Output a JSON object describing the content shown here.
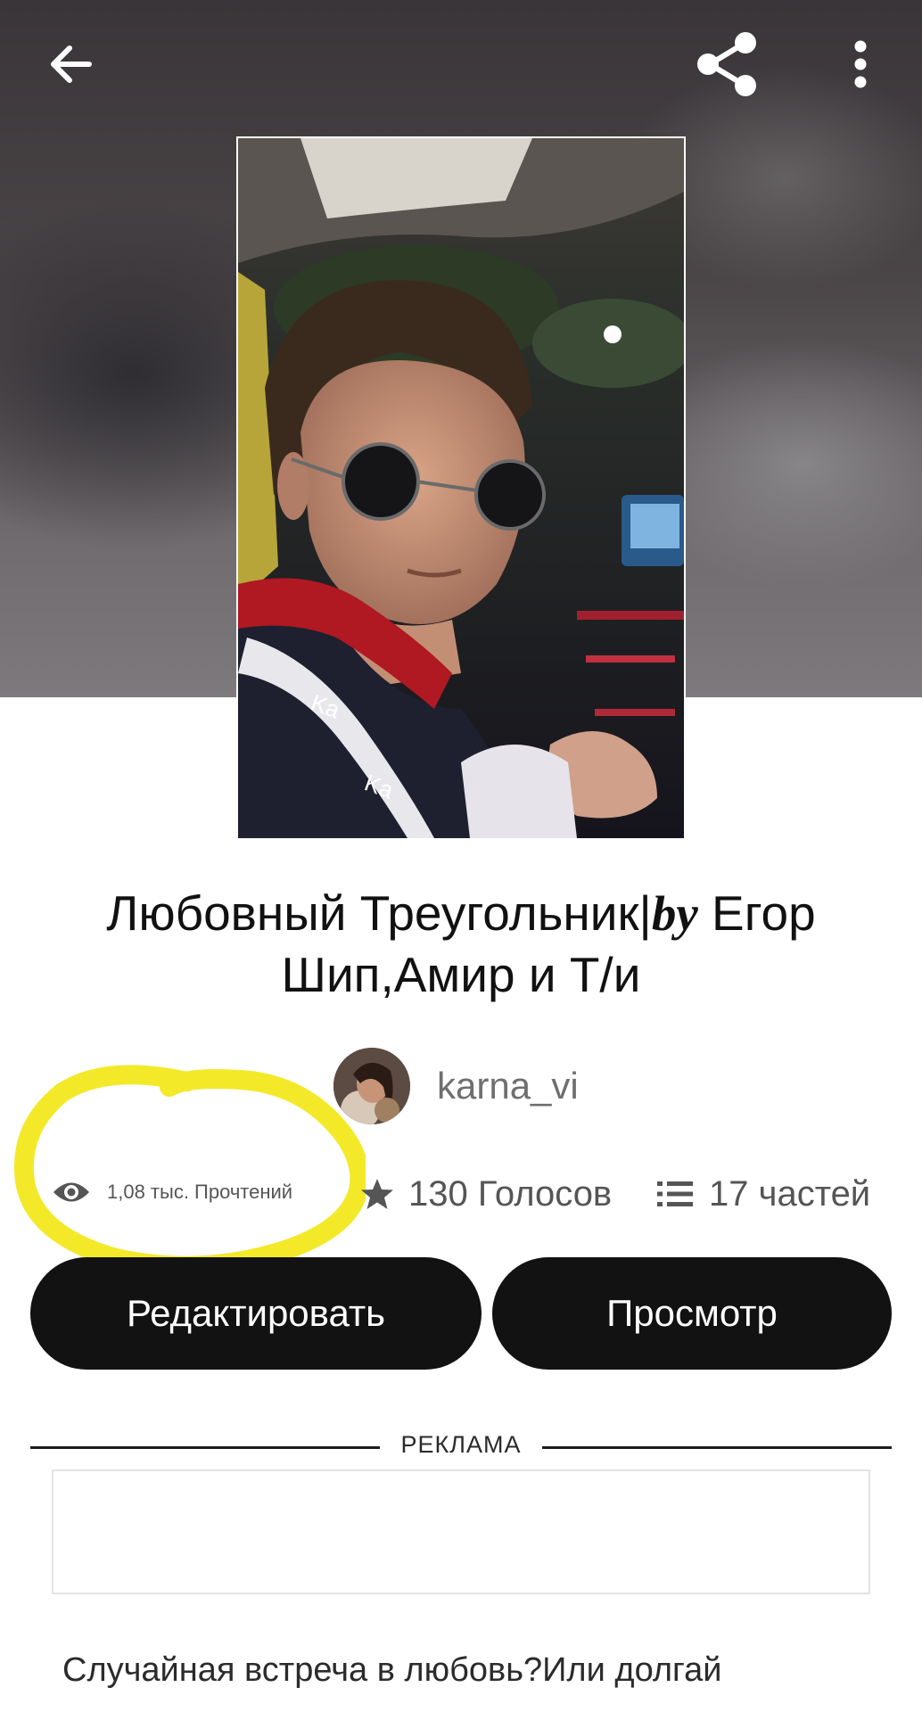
{
  "header": {
    "back_icon": "arrow-left-icon",
    "share_icon": "share-icon",
    "more_icon": "more-vertical-icon"
  },
  "story": {
    "title_part1": "Любовный Треугольник|",
    "title_by": "by",
    "title_part2": " Егор Шип,Амир и Т/и",
    "author": "karna_vi"
  },
  "stats": {
    "reads": "1,08 тыс. Прочтений",
    "votes": "130 Голосов",
    "parts": "17 частей"
  },
  "buttons": {
    "edit": "Редактировать",
    "view": "Просмотр"
  },
  "ad": {
    "label": "РЕКЛАМА"
  },
  "description": {
    "text": "Случайная встреча в любовь?Или долгай"
  },
  "colors": {
    "button_bg": "#121212",
    "highlight": "#f3e81e",
    "stat_text": "#555555"
  }
}
